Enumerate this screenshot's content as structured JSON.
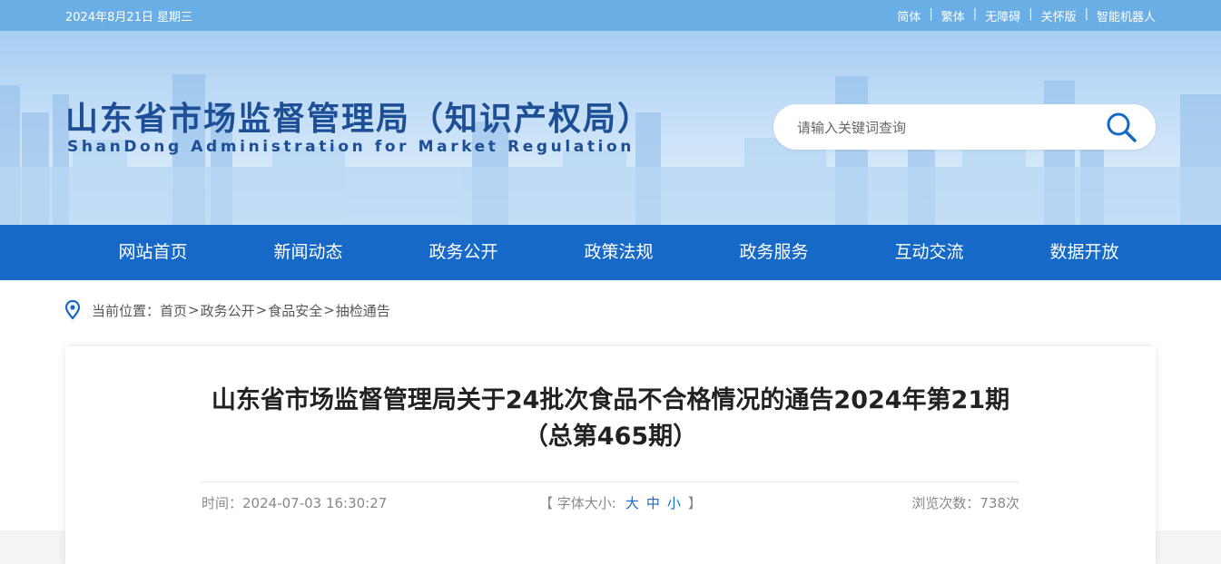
{
  "topbar": {
    "date": "2024年8月21日 星期三",
    "links": [
      "简体",
      "繁体",
      "无障碍",
      "关怀版",
      "智能机器人"
    ],
    "separator": "|"
  },
  "header": {
    "title_cn": "山东省市场监督管理局（知识产权局）",
    "title_en": "ShanDong Administration for Market Regulation",
    "search_placeholder": "请输入关键词查询",
    "search_icon": "search-icon",
    "text_color": "#1c4f95"
  },
  "nav": {
    "items": [
      "网站首页",
      "新闻动态",
      "政务公开",
      "政策法规",
      "政务服务",
      "互动交流",
      "数据开放"
    ],
    "background": "#1769c7"
  },
  "breadcrumb": {
    "icon": "location-pin-icon",
    "label": "当前位置：",
    "items": [
      "首页",
      "政务公开",
      "食品安全",
      "抽检通告"
    ],
    "arrow": ">"
  },
  "article": {
    "title": "山东省市场监督管理局关于24批次食品不合格情况的通告2024年第21期（总第465期）",
    "time_label": "时间：",
    "time": "2024-07-03 16:30:27",
    "font_size_open": "【 字体大小:",
    "font_size_options": [
      "大",
      "中",
      "小"
    ],
    "font_size_close": "】",
    "views_label": "浏览次数：",
    "views": "738次"
  },
  "colors": {
    "topbar": "#6aaee6",
    "accent": "#1769c7"
  }
}
